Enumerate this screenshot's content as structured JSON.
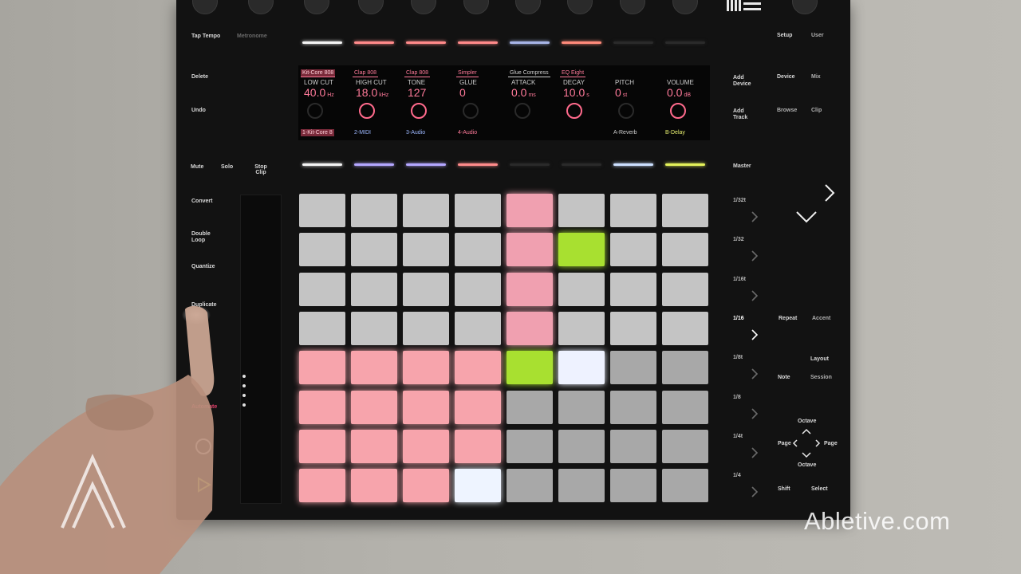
{
  "top_left": {
    "tap_tempo": "Tap Tempo",
    "metronome": "Metronome"
  },
  "left_column": {
    "delete": "Delete",
    "undo": "Undo",
    "mute": "Mute",
    "solo": "Solo",
    "stop_clip": "Stop Clip",
    "convert": "Convert",
    "double_loop": "Double Loop",
    "quantize": "Quantize",
    "duplicate": "Duplicate",
    "automate": "Automate"
  },
  "display": {
    "tabs": [
      {
        "label": "Kit-Core 808",
        "color": "#ff7a9a",
        "selected": true
      },
      {
        "label": "Clap 808",
        "color": "#ff7a9a",
        "selected": false
      },
      {
        "label": "Clap 808",
        "color": "#ff7a9a",
        "selected": false
      },
      {
        "label": "Simpler",
        "color": "#ff7a9a",
        "selected": false
      },
      {
        "label": "Glue Compress",
        "color": "#cfcfcf",
        "selected": false
      },
      {
        "label": "EQ Eight",
        "color": "#ff7a9a",
        "selected": false
      }
    ],
    "params": [
      {
        "name": "LOW CUT",
        "value": "40.0",
        "unit": "Hz",
        "knob": false
      },
      {
        "name": "HIGH CUT",
        "value": "18.0",
        "unit": "kHz",
        "knob": true
      },
      {
        "name": "TONE",
        "value": "127",
        "unit": "",
        "knob": true
      },
      {
        "name": "GLUE",
        "value": "0",
        "unit": "",
        "knob": false
      },
      {
        "name": "ATTACK",
        "value": "0.0",
        "unit": "ms",
        "knob": false
      },
      {
        "name": "DECAY",
        "value": "10.0",
        "unit": "s",
        "knob": true
      },
      {
        "name": "PITCH",
        "value": "0",
        "unit": "st",
        "knob": false
      },
      {
        "name": "VOLUME",
        "value": "0.0",
        "unit": "dB",
        "knob": true
      }
    ],
    "tracks": [
      {
        "label": "1-Kit-Core 8",
        "color": "#ff7a9a",
        "selected": true
      },
      {
        "label": "2-MIDI",
        "color": "#9db8ff",
        "selected": false
      },
      {
        "label": "3-Audio",
        "color": "#9db8ff",
        "selected": false
      },
      {
        "label": "4-Audio",
        "color": "#ff7a9a",
        "selected": false
      },
      {
        "label": "",
        "color": "#cfcfcf",
        "selected": false
      },
      {
        "label": "",
        "color": "#cfcfcf",
        "selected": false
      },
      {
        "label": "A-Reverb",
        "color": "#cfcfcf",
        "selected": false
      },
      {
        "label": "B-Delay",
        "color": "#e8f070",
        "selected": false
      }
    ]
  },
  "upper_strip_colors": [
    "#f4f4f4",
    "#ff8a8a",
    "#ff8a8a",
    "#ff8a8a",
    "#a6b4e6",
    "#ff8a7a",
    "#2a2a2a",
    "#2a2a2a"
  ],
  "lower_strip_colors": [
    "#f4f4f4",
    "#b4a6ff",
    "#b4a6ff",
    "#ff8a8a",
    "#2a2a2a",
    "#2a2a2a",
    "#cce0ff",
    "#e4f25a"
  ],
  "right_column": {
    "add_device": "Add Device",
    "add_track": "Add Track",
    "master": "Master",
    "divisions": [
      "1/32t",
      "1/32",
      "1/16t",
      "1/16",
      "1/8t",
      "1/8",
      "1/4t",
      "1/4"
    ]
  },
  "far_right": {
    "setup": "Setup",
    "user": "User",
    "device": "Device",
    "mix": "Mix",
    "browse": "Browse",
    "clip": "Clip",
    "repeat": "Repeat",
    "accent": "Accent",
    "layout": "Layout",
    "note": "Note",
    "session": "Session",
    "octave_up": "Octave",
    "octave_down": "Octave",
    "page_left": "Page",
    "page_right": "Page",
    "shift": "Shift",
    "select": "Select"
  },
  "pad_rows": [
    [
      "#c4c4c4",
      "#c4c4c4",
      "#c4c4c4",
      "#c4c4c4",
      "#f0a0b0",
      "#c4c4c4",
      "#c4c4c4",
      "#c4c4c4"
    ],
    [
      "#c4c4c4",
      "#c4c4c4",
      "#c4c4c4",
      "#c4c4c4",
      "#f0a0b0",
      "#a8e030",
      "#c4c4c4",
      "#c4c4c4"
    ],
    [
      "#c4c4c4",
      "#c4c4c4",
      "#c4c4c4",
      "#c4c4c4",
      "#f0a0b0",
      "#c4c4c4",
      "#c4c4c4",
      "#c4c4c4"
    ],
    [
      "#c4c4c4",
      "#c4c4c4",
      "#c4c4c4",
      "#c4c4c4",
      "#f0a0b0",
      "#c4c4c4",
      "#c4c4c4",
      "#c4c4c4"
    ],
    [
      "#f7a4ac",
      "#f7a4ac",
      "#f7a4ac",
      "#f7a4ac",
      "#a8e030",
      "#eef2ff",
      "#a8a8a8",
      "#a8a8a8"
    ],
    [
      "#f7a4ac",
      "#f7a4ac",
      "#f7a4ac",
      "#f7a4ac",
      "#a8a8a8",
      "#a8a8a8",
      "#a8a8a8",
      "#a8a8a8"
    ],
    [
      "#f7a4ac",
      "#f7a4ac",
      "#f7a4ac",
      "#f7a4ac",
      "#a8a8a8",
      "#a8a8a8",
      "#a8a8a8",
      "#a8a8a8"
    ],
    [
      "#f7a4ac",
      "#f7a4ac",
      "#f7a4ac",
      "#eef4ff",
      "#a8a8a8",
      "#a8a8a8",
      "#a8a8a8",
      "#a8a8a8"
    ]
  ],
  "watermark": "Abletive.com",
  "colors": {
    "accent_pink": "#ff7a9a",
    "lime": "#a8e030",
    "play_green": "#c8e040",
    "automate_red": "#e0406a"
  }
}
